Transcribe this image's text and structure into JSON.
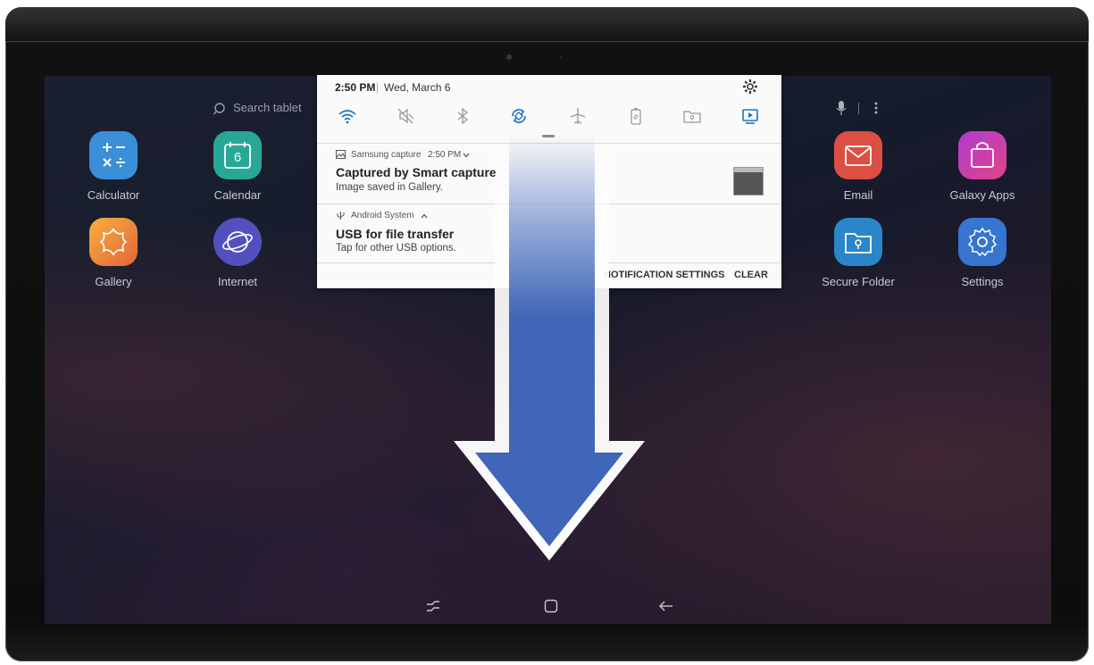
{
  "home": {
    "search_placeholder": "Search tablet",
    "apps": [
      {
        "label": "Calculator",
        "color": "#3a9be0"
      },
      {
        "label": "Calendar",
        "color": "#2bb5a0"
      },
      {
        "label": "Email",
        "color": "#e3564b"
      },
      {
        "label": "Galaxy Apps",
        "color": "#d43d8c"
      },
      {
        "label": "Gallery",
        "color": "#f2a03a"
      },
      {
        "label": "Internet",
        "color": "#5b56c8"
      },
      {
        "label": "Secure Folder",
        "color": "#2d8fd0"
      },
      {
        "label": "Settings",
        "color": "#3b7fd8"
      }
    ],
    "calendar_day": "6"
  },
  "panel": {
    "time": "2:50 PM",
    "date": "Wed, March 6",
    "quick_settings": [
      "wifi-icon",
      "mute-icon",
      "bluetooth-icon",
      "auto-rotate-icon",
      "airplane-mode-icon",
      "power-saving-icon",
      "secure-folder-icon",
      "screen-mirroring-icon"
    ],
    "notifications": [
      {
        "app": "Samsung capture",
        "time": "2:50 PM",
        "title": "Captured by Smart capture",
        "body": "Image saved in Gallery."
      },
      {
        "app": "Android System",
        "title": "USB for file transfer",
        "body": "Tap for other USB options."
      }
    ],
    "actions": {
      "settings": "NOTIFICATION SETTINGS",
      "clear": "CLEAR"
    }
  },
  "colors": {
    "accent": "#1a73c9",
    "arrow": "#3f66b8"
  },
  "nav": [
    "recent-apps-icon",
    "home-icon",
    "back-icon"
  ]
}
